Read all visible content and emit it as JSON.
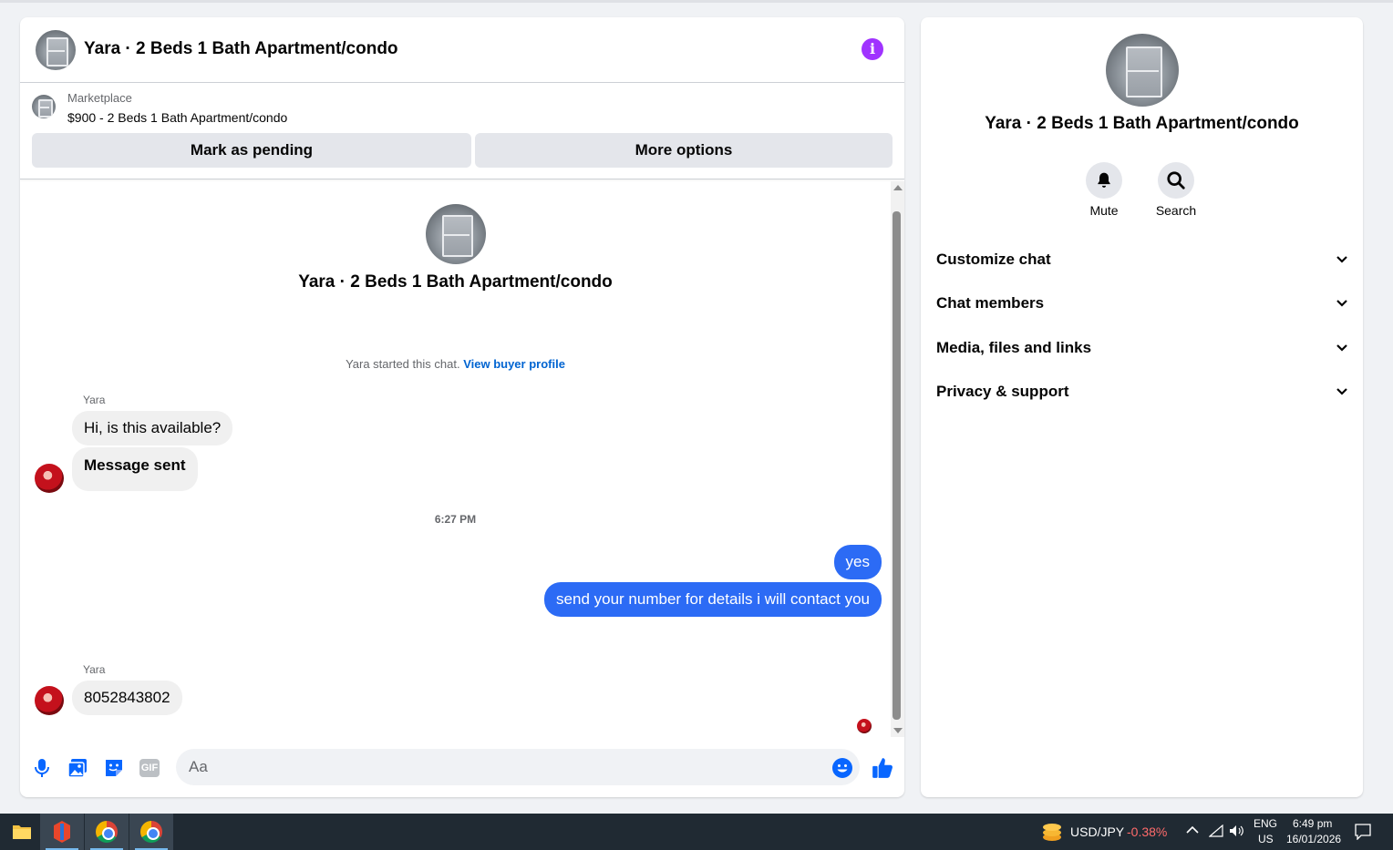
{
  "conversation": {
    "title": "Yara · 2 Beds 1 Bath Apartment/condo",
    "info_icon": "info-icon"
  },
  "marketplace": {
    "label": "Marketplace",
    "listing": "$900 - 2 Beds 1 Bath Apartment/condo",
    "mark_pending_label": "Mark as pending",
    "more_options_label": "More options"
  },
  "thread": {
    "header_title": "Yara · 2 Beds 1 Bath Apartment/condo",
    "started_text": "Yara started this chat.",
    "view_profile_link": "View buyer profile",
    "messages": [
      {
        "sender": "Yara",
        "text": "Hi, is this available?",
        "direction": "incoming"
      },
      {
        "sender": "",
        "text": "Message sent",
        "direction": "incoming"
      },
      {
        "timestamp": "6:27 PM"
      },
      {
        "text": "yes",
        "direction": "outgoing"
      },
      {
        "text": "send your number for details i will contact you",
        "direction": "outgoing"
      },
      {
        "sender": "Yara",
        "text": "8052843802",
        "direction": "incoming"
      }
    ]
  },
  "composer": {
    "placeholder": "Aa",
    "icons": [
      "microphone-icon",
      "photo-icon",
      "sticker-icon",
      "gif-icon",
      "emoji-icon",
      "thumbs-up-icon"
    ],
    "gif_label": "GIF"
  },
  "sidebar": {
    "title": "Yara · 2 Beds 1 Bath Apartment/condo",
    "mute_label": "Mute",
    "search_label": "Search",
    "sections": [
      {
        "label": "Customize chat"
      },
      {
        "label": "Chat members"
      },
      {
        "label": "Media, files and links"
      },
      {
        "label": "Privacy & support"
      }
    ]
  },
  "taskbar": {
    "ticker": "USD/JPY",
    "ticker_change": "-0.38%",
    "ticker_change_color": "#ff6b6b",
    "lang_top": "ENG",
    "lang_bottom": "US",
    "time": "6:49 pm",
    "date": "16/01/2026"
  },
  "colors": {
    "outgoing_bubble": "#2c6bf5",
    "accent_link": "#0064d1",
    "info_icon": "#a033ff"
  }
}
